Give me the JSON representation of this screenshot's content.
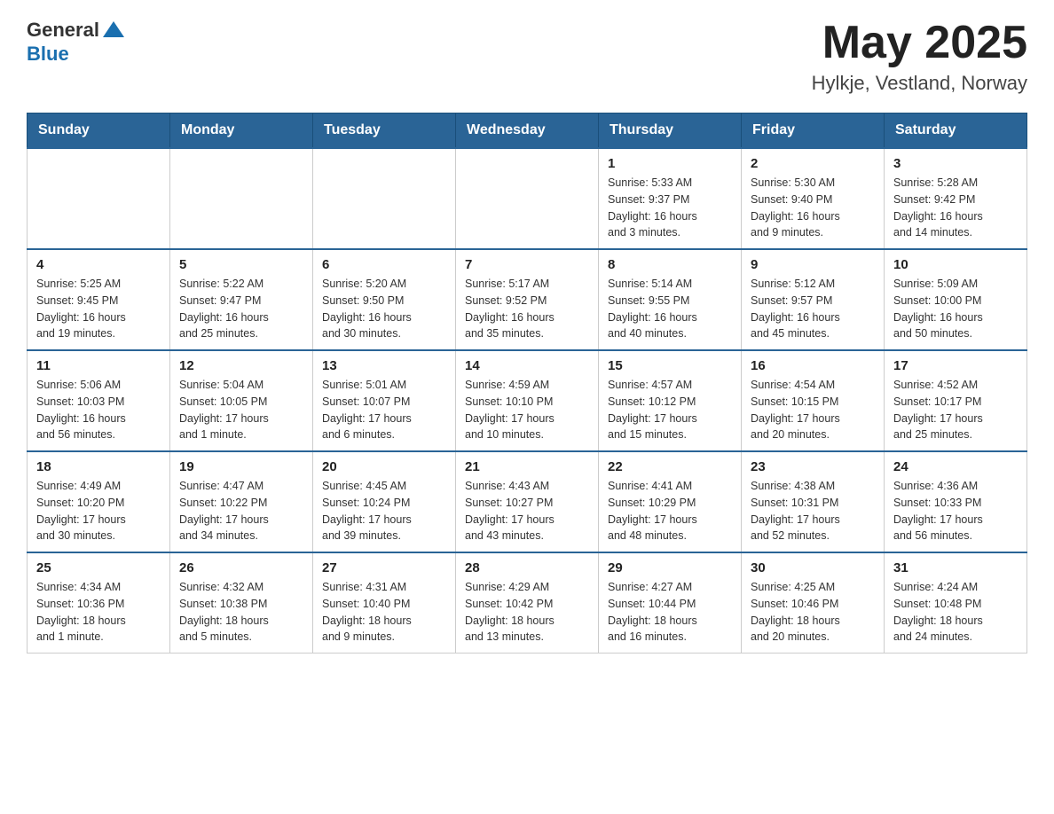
{
  "header": {
    "logo_general": "General",
    "logo_blue": "Blue",
    "month_year": "May 2025",
    "location": "Hylkje, Vestland, Norway"
  },
  "days_of_week": [
    "Sunday",
    "Monday",
    "Tuesday",
    "Wednesday",
    "Thursday",
    "Friday",
    "Saturday"
  ],
  "weeks": [
    [
      {
        "day": "",
        "info": ""
      },
      {
        "day": "",
        "info": ""
      },
      {
        "day": "",
        "info": ""
      },
      {
        "day": "",
        "info": ""
      },
      {
        "day": "1",
        "info": "Sunrise: 5:33 AM\nSunset: 9:37 PM\nDaylight: 16 hours\nand 3 minutes."
      },
      {
        "day": "2",
        "info": "Sunrise: 5:30 AM\nSunset: 9:40 PM\nDaylight: 16 hours\nand 9 minutes."
      },
      {
        "day": "3",
        "info": "Sunrise: 5:28 AM\nSunset: 9:42 PM\nDaylight: 16 hours\nand 14 minutes."
      }
    ],
    [
      {
        "day": "4",
        "info": "Sunrise: 5:25 AM\nSunset: 9:45 PM\nDaylight: 16 hours\nand 19 minutes."
      },
      {
        "day": "5",
        "info": "Sunrise: 5:22 AM\nSunset: 9:47 PM\nDaylight: 16 hours\nand 25 minutes."
      },
      {
        "day": "6",
        "info": "Sunrise: 5:20 AM\nSunset: 9:50 PM\nDaylight: 16 hours\nand 30 minutes."
      },
      {
        "day": "7",
        "info": "Sunrise: 5:17 AM\nSunset: 9:52 PM\nDaylight: 16 hours\nand 35 minutes."
      },
      {
        "day": "8",
        "info": "Sunrise: 5:14 AM\nSunset: 9:55 PM\nDaylight: 16 hours\nand 40 minutes."
      },
      {
        "day": "9",
        "info": "Sunrise: 5:12 AM\nSunset: 9:57 PM\nDaylight: 16 hours\nand 45 minutes."
      },
      {
        "day": "10",
        "info": "Sunrise: 5:09 AM\nSunset: 10:00 PM\nDaylight: 16 hours\nand 50 minutes."
      }
    ],
    [
      {
        "day": "11",
        "info": "Sunrise: 5:06 AM\nSunset: 10:03 PM\nDaylight: 16 hours\nand 56 minutes."
      },
      {
        "day": "12",
        "info": "Sunrise: 5:04 AM\nSunset: 10:05 PM\nDaylight: 17 hours\nand 1 minute."
      },
      {
        "day": "13",
        "info": "Sunrise: 5:01 AM\nSunset: 10:07 PM\nDaylight: 17 hours\nand 6 minutes."
      },
      {
        "day": "14",
        "info": "Sunrise: 4:59 AM\nSunset: 10:10 PM\nDaylight: 17 hours\nand 10 minutes."
      },
      {
        "day": "15",
        "info": "Sunrise: 4:57 AM\nSunset: 10:12 PM\nDaylight: 17 hours\nand 15 minutes."
      },
      {
        "day": "16",
        "info": "Sunrise: 4:54 AM\nSunset: 10:15 PM\nDaylight: 17 hours\nand 20 minutes."
      },
      {
        "day": "17",
        "info": "Sunrise: 4:52 AM\nSunset: 10:17 PM\nDaylight: 17 hours\nand 25 minutes."
      }
    ],
    [
      {
        "day": "18",
        "info": "Sunrise: 4:49 AM\nSunset: 10:20 PM\nDaylight: 17 hours\nand 30 minutes."
      },
      {
        "day": "19",
        "info": "Sunrise: 4:47 AM\nSunset: 10:22 PM\nDaylight: 17 hours\nand 34 minutes."
      },
      {
        "day": "20",
        "info": "Sunrise: 4:45 AM\nSunset: 10:24 PM\nDaylight: 17 hours\nand 39 minutes."
      },
      {
        "day": "21",
        "info": "Sunrise: 4:43 AM\nSunset: 10:27 PM\nDaylight: 17 hours\nand 43 minutes."
      },
      {
        "day": "22",
        "info": "Sunrise: 4:41 AM\nSunset: 10:29 PM\nDaylight: 17 hours\nand 48 minutes."
      },
      {
        "day": "23",
        "info": "Sunrise: 4:38 AM\nSunset: 10:31 PM\nDaylight: 17 hours\nand 52 minutes."
      },
      {
        "day": "24",
        "info": "Sunrise: 4:36 AM\nSunset: 10:33 PM\nDaylight: 17 hours\nand 56 minutes."
      }
    ],
    [
      {
        "day": "25",
        "info": "Sunrise: 4:34 AM\nSunset: 10:36 PM\nDaylight: 18 hours\nand 1 minute."
      },
      {
        "day": "26",
        "info": "Sunrise: 4:32 AM\nSunset: 10:38 PM\nDaylight: 18 hours\nand 5 minutes."
      },
      {
        "day": "27",
        "info": "Sunrise: 4:31 AM\nSunset: 10:40 PM\nDaylight: 18 hours\nand 9 minutes."
      },
      {
        "day": "28",
        "info": "Sunrise: 4:29 AM\nSunset: 10:42 PM\nDaylight: 18 hours\nand 13 minutes."
      },
      {
        "day": "29",
        "info": "Sunrise: 4:27 AM\nSunset: 10:44 PM\nDaylight: 18 hours\nand 16 minutes."
      },
      {
        "day": "30",
        "info": "Sunrise: 4:25 AM\nSunset: 10:46 PM\nDaylight: 18 hours\nand 20 minutes."
      },
      {
        "day": "31",
        "info": "Sunrise: 4:24 AM\nSunset: 10:48 PM\nDaylight: 18 hours\nand 24 minutes."
      }
    ]
  ]
}
